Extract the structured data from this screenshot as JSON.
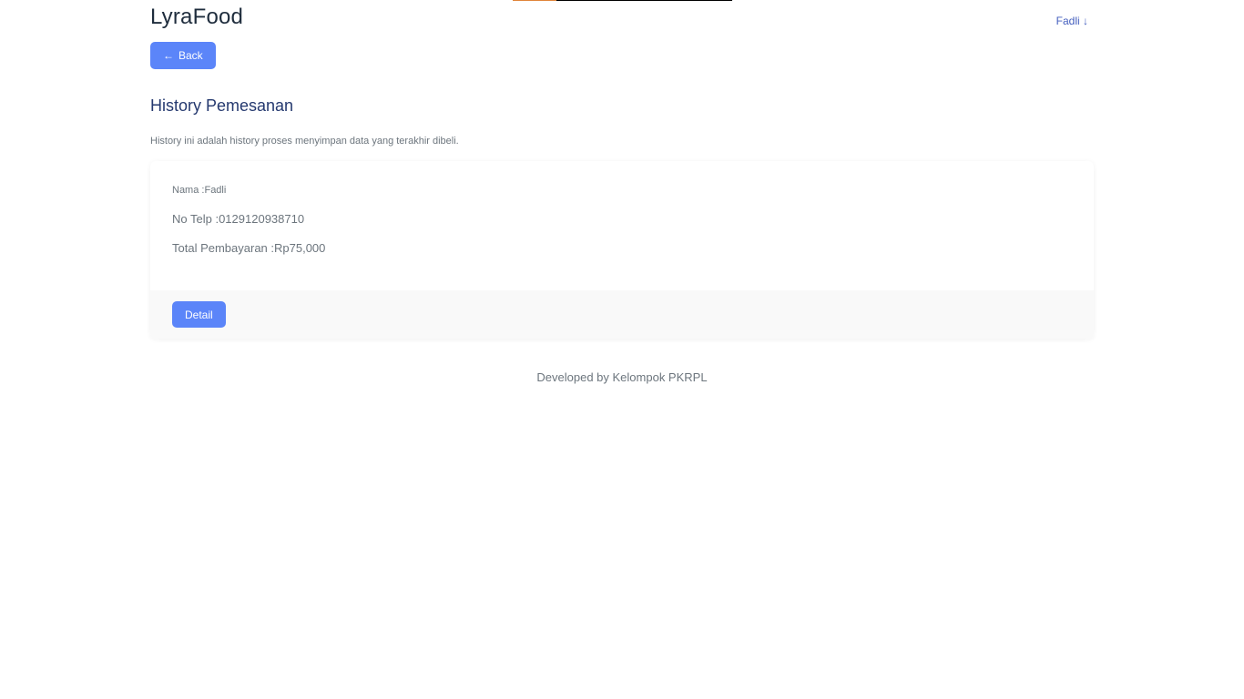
{
  "header": {
    "brand": "LyraFood",
    "user_name": "Fadli",
    "user_dropdown_glyph": "↓"
  },
  "nav": {
    "back_arrow": "←",
    "back_label": "Back"
  },
  "main": {
    "title": "History Pemesanan",
    "subtitle": "History ini adalah history proses menyimpan data yang terakhir dibeli."
  },
  "order": {
    "nama_label": "Nama :",
    "nama_value": "Fadli",
    "telp_label": "No Telp :",
    "telp_value": "0129120938710",
    "total_label": "Total Pembayaran :",
    "total_value": "Rp75,000",
    "detail_label": "Detail"
  },
  "footer": {
    "text": "Developed by Kelompok PKRPL"
  },
  "colors": {
    "primary": "#5b85f9",
    "link": "#435ebe",
    "text_dark": "#25396f",
    "text_muted": "#6c757d",
    "footer_bg": "#f9f9f9"
  }
}
